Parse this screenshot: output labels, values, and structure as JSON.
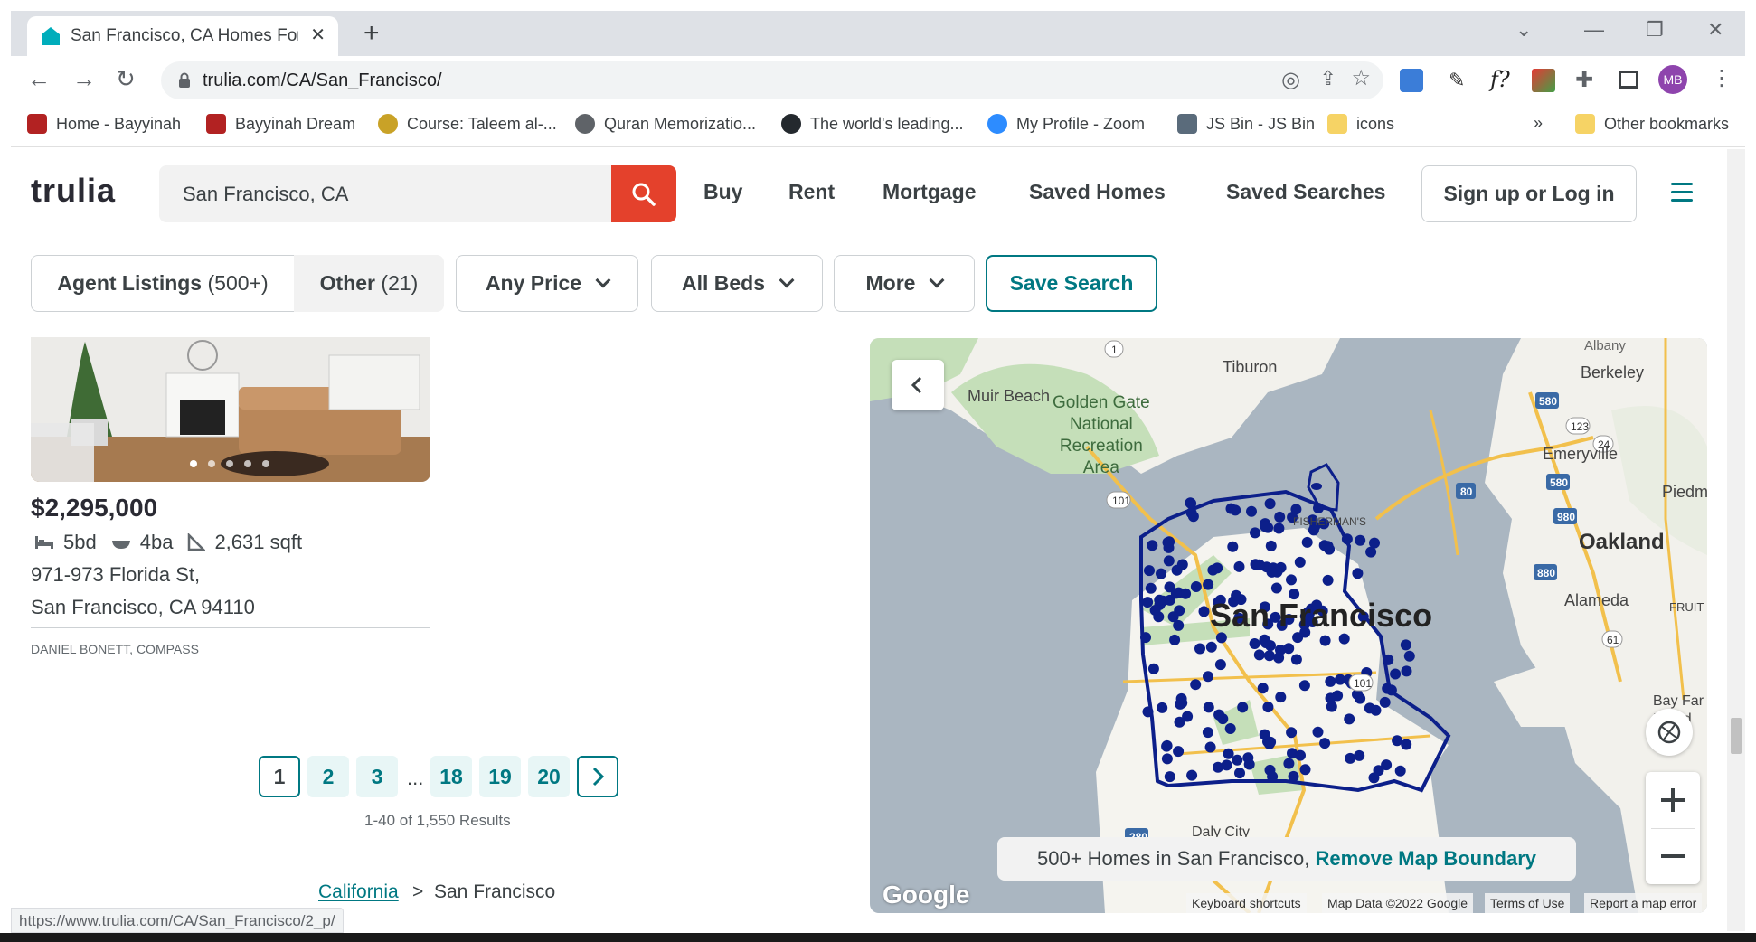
{
  "browser": {
    "tab_title": "San Francisco, CA Homes For Sal",
    "url_host": "trulia.com",
    "url_path": "/CA/San_Francisco/",
    "status_url": "https://www.trulia.com/CA/San_Francisco/2_p/",
    "profile_initials": "MB",
    "bookmarks": [
      {
        "label": "Home - Bayyinah",
        "color": "#b22222"
      },
      {
        "label": "Bayyinah Dream",
        "color": "#b22222"
      },
      {
        "label": "Course: Taleem al-...",
        "color": "#c9a227"
      },
      {
        "label": "Quran Memorizatio...",
        "color": "#5f6368"
      },
      {
        "label": "The world's leading...",
        "color": "#24292e"
      },
      {
        "label": "My Profile - Zoom",
        "color": "#2d8cff"
      },
      {
        "label": "JS Bin - JS Bin",
        "color": "#5a6b7b"
      },
      {
        "label": "icons",
        "color": "#f6d365"
      }
    ],
    "bookmarks_overflow": "»",
    "other_bookmarks": "Other bookmarks"
  },
  "header": {
    "logo": "trulia",
    "search_value": "San Francisco, CA",
    "nav": [
      "Buy",
      "Rent",
      "Mortgage",
      "Saved Homes",
      "Saved Searches"
    ],
    "login": "Sign up or Log in"
  },
  "filters": {
    "agent_listings": "Agent Listings",
    "agent_count": "(500+)",
    "other": "Other",
    "other_count": "(21)",
    "price": "Any Price",
    "beds": "All Beds",
    "more": "More",
    "save_search": "Save Search"
  },
  "listing": {
    "price": "$2,295,000",
    "beds": "5bd",
    "baths": "4ba",
    "sqft": "2,631 sqft",
    "address_line1": "971-973 Florida St,",
    "address_line2": "San Francisco, CA 94110",
    "agent": "DANIEL BONETT, COMPASS",
    "photo_dots": 5
  },
  "pagination": {
    "pages": [
      "1",
      "2",
      "3",
      "18",
      "19",
      "20"
    ],
    "ellipsis": "...",
    "current": "1",
    "results": "1-40 of 1,550 Results"
  },
  "breadcrumb": {
    "state": "California",
    "separator": ">",
    "city": "San Francisco"
  },
  "map": {
    "banner_text": "500+ Homes in San Francisco,",
    "banner_link": "Remove Map Boundary",
    "google": "Google",
    "attribution": [
      "Keyboard shortcuts",
      "Map Data ©2022 Google",
      "Terms of Use",
      "Report a map error"
    ],
    "labels": {
      "tiburon": "Tiburon",
      "berkeley": "Berkeley",
      "muir_beach": "Muir Beach",
      "golden_gate": "Golden Gate\nNational\nRecreation\nArea",
      "emeryville": "Emeryville",
      "piedmont": "Piedm",
      "oakland": "Oakland",
      "alameda": "Alameda",
      "fruitvale": "FRUIT",
      "bay_farm": "Bay Far\nIsland",
      "fishermans": "FISHERMAN'S",
      "sf": "San Francisco",
      "daly_city": "Daly City",
      "albany": "Albany"
    },
    "highways": [
      "1",
      "101",
      "580",
      "123",
      "24",
      "80",
      "980",
      "880",
      "61",
      "280",
      "101",
      "280"
    ],
    "colors": {
      "water": "#aab6c1",
      "land": "#f5f5f2",
      "park": "#c5dfb9",
      "road": "#f2c04c",
      "pin": "#0c1f8a",
      "boundary": "#0c1f8a"
    }
  }
}
